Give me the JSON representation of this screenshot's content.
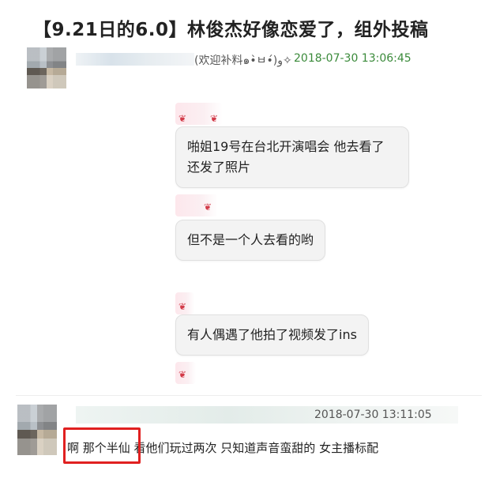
{
  "page": {
    "title": "【9.21日的6.0】林俊杰好像恋爱了，组外投稿"
  },
  "post1": {
    "nickname_suffix": "(欢迎补料๑•̀ㅂ•́)و✧",
    "timestamp": "2018-07-30 13:06:45"
  },
  "chat": {
    "messages": [
      {
        "line1": "啪姐19号在台北开演唱会 他去看了",
        "line2": "还发了照片"
      },
      {
        "line1": "但不是一个人去看的哟"
      },
      {
        "line1": "有人偶遇了他拍了视频发了ins"
      }
    ]
  },
  "post2": {
    "timestamp": "2018-07-30 13:11:05",
    "comment": "啊 那个半仙 看他们玩过两次 只知道声音蛮甜的 女主播标配"
  },
  "colors": {
    "timestamp_green": "#3a8a3a",
    "highlight_red": "#e02020",
    "bubble_bg": "#f3f3f3"
  }
}
